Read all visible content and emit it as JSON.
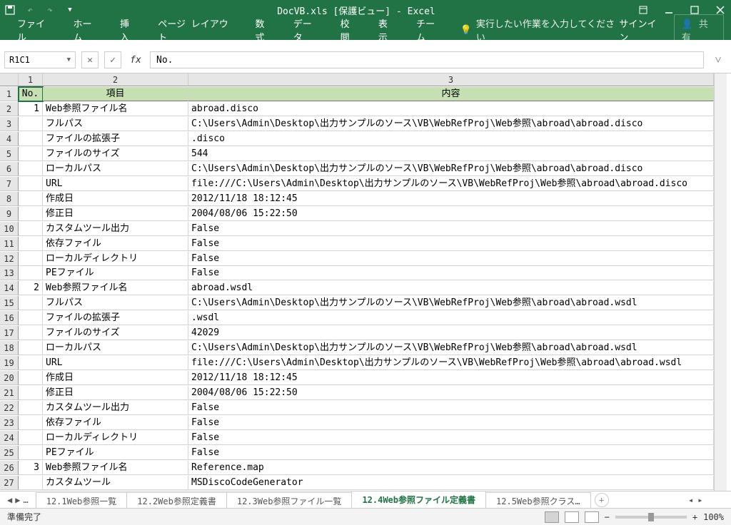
{
  "titlebar": {
    "title": "DocVB.xls  [保護ビュー] - Excel"
  },
  "ribbon": {
    "tabs": [
      "ファイル",
      "ホーム",
      "挿入",
      "ページ レイアウト",
      "数式",
      "データ",
      "校閲",
      "表示",
      "チーム"
    ],
    "tell": "実行したい作業を入力してください",
    "signin": "サインイン",
    "share": "共有"
  },
  "formula": {
    "namebox": "R1C1",
    "value": "No."
  },
  "headers": {
    "no": "No.",
    "item": "項目",
    "content": "内容"
  },
  "colLabels": [
    "1",
    "2",
    "3"
  ],
  "rows": [
    {
      "r": 2,
      "no": "1",
      "item": "Web参照ファイル名",
      "content": "abroad.disco"
    },
    {
      "r": 3,
      "no": "",
      "item": "フルパス",
      "content": "C:\\Users\\Admin\\Desktop\\出力サンプルのソース\\VB\\WebRefProj\\Web参照\\abroad\\abroad.disco"
    },
    {
      "r": 4,
      "no": "",
      "item": "ファイルの拡張子",
      "content": ".disco"
    },
    {
      "r": 5,
      "no": "",
      "item": "ファイルのサイズ",
      "content": "544"
    },
    {
      "r": 6,
      "no": "",
      "item": "ローカルパス",
      "content": "C:\\Users\\Admin\\Desktop\\出力サンプルのソース\\VB\\WebRefProj\\Web参照\\abroad\\abroad.disco"
    },
    {
      "r": 7,
      "no": "",
      "item": "URL",
      "content": "file:///C:\\Users\\Admin\\Desktop\\出力サンプルのソース\\VB\\WebRefProj\\Web参照\\abroad\\abroad.disco"
    },
    {
      "r": 8,
      "no": "",
      "item": "作成日",
      "content": "2012/11/18 18:12:45"
    },
    {
      "r": 9,
      "no": "",
      "item": "修正日",
      "content": "2004/08/06 15:22:50"
    },
    {
      "r": 10,
      "no": "",
      "item": "カスタムツール出力",
      "content": "False"
    },
    {
      "r": 11,
      "no": "",
      "item": "依存ファイル",
      "content": "False"
    },
    {
      "r": 12,
      "no": "",
      "item": "ローカルディレクトリ",
      "content": "False"
    },
    {
      "r": 13,
      "no": "",
      "item": "PEファイル",
      "content": "False"
    },
    {
      "r": 14,
      "no": "2",
      "item": "Web参照ファイル名",
      "content": "abroad.wsdl"
    },
    {
      "r": 15,
      "no": "",
      "item": "フルパス",
      "content": "C:\\Users\\Admin\\Desktop\\出力サンプルのソース\\VB\\WebRefProj\\Web参照\\abroad\\abroad.wsdl"
    },
    {
      "r": 16,
      "no": "",
      "item": "ファイルの拡張子",
      "content": ".wsdl"
    },
    {
      "r": 17,
      "no": "",
      "item": "ファイルのサイズ",
      "content": "42029"
    },
    {
      "r": 18,
      "no": "",
      "item": "ローカルパス",
      "content": "C:\\Users\\Admin\\Desktop\\出力サンプルのソース\\VB\\WebRefProj\\Web参照\\abroad\\abroad.wsdl"
    },
    {
      "r": 19,
      "no": "",
      "item": "URL",
      "content": "file:///C:\\Users\\Admin\\Desktop\\出力サンプルのソース\\VB\\WebRefProj\\Web参照\\abroad\\abroad.wsdl"
    },
    {
      "r": 20,
      "no": "",
      "item": "作成日",
      "content": "2012/11/18 18:12:45"
    },
    {
      "r": 21,
      "no": "",
      "item": "修正日",
      "content": "2004/08/06 15:22:50"
    },
    {
      "r": 22,
      "no": "",
      "item": "カスタムツール出力",
      "content": "False"
    },
    {
      "r": 23,
      "no": "",
      "item": "依存ファイル",
      "content": "False"
    },
    {
      "r": 24,
      "no": "",
      "item": "ローカルディレクトリ",
      "content": "False"
    },
    {
      "r": 25,
      "no": "",
      "item": "PEファイル",
      "content": "False"
    },
    {
      "r": 26,
      "no": "3",
      "item": "Web参照ファイル名",
      "content": "Reference.map"
    },
    {
      "r": 27,
      "no": "",
      "item": "カスタムツール",
      "content": "MSDiscoCodeGenerator"
    }
  ],
  "tabs": {
    "sheets": [
      "12.1Web参照一覧",
      "12.2Web参照定義書",
      "12.3Web参照ファイル一覧",
      "12.4Web参照ファイル定義書",
      "12.5Web参照クラス…"
    ],
    "active": 3
  },
  "status": {
    "ready": "準備完了",
    "zoom": "100%"
  }
}
